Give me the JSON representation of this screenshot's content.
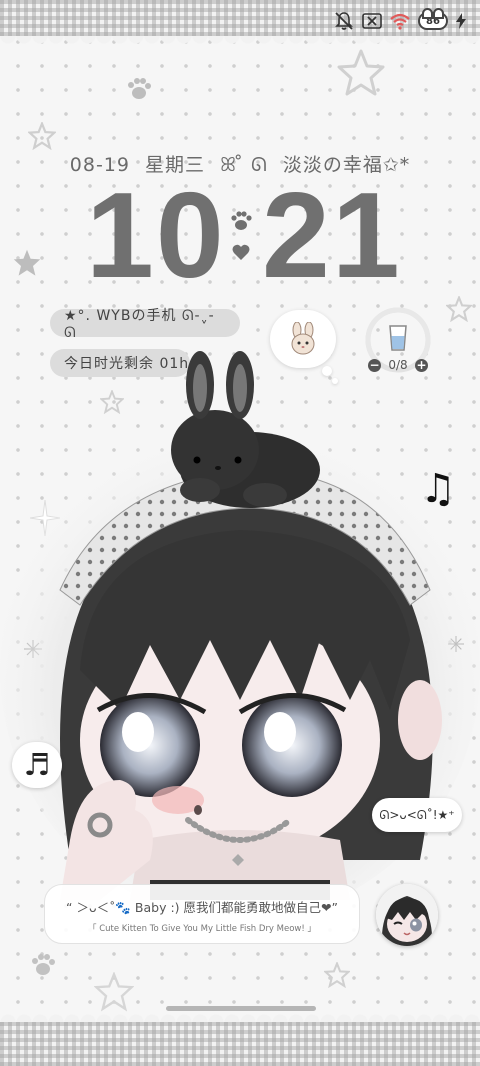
{
  "status_bar": {
    "battery_level": "86",
    "icons": [
      "mute-bell-icon",
      "no-sim-icon",
      "wifi-icon",
      "battery-icon",
      "charging-bolt-icon"
    ]
  },
  "date_line": {
    "date": "08-19",
    "weekday": "星期三",
    "decor": "ꕤ ̊ ᘏ",
    "motto": "淡淡の幸福✩*"
  },
  "clock": {
    "hours": "10",
    "minutes": "21"
  },
  "device_pill": {
    "text": "★°. WYBの手机 ᘏ-ˬ-ᘏ"
  },
  "remaining_pill": {
    "text": "今日时光剩余 01h"
  },
  "water_widget": {
    "count": "0/8",
    "minus": "−",
    "plus": "+"
  },
  "kaomoji_bubble": {
    "text": "ᘏ>ᴗ<ᘏ˚!★⁺"
  },
  "quote": {
    "main": "“ ＞ᴗ＜˚🐾 Baby :) 愿我们都能勇敢地做自己❤”",
    "sub": "「 Cute Kitten To Give You My Little Fish Dry Meow! 」"
  },
  "colors": {
    "clock": "#707070",
    "pill_bg": "#dcdcdc",
    "background": "#f6f6f6"
  }
}
